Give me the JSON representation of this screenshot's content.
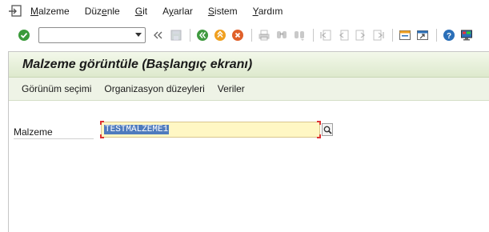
{
  "menubar": {
    "items": [
      {
        "label": "Malzeme",
        "mnemonic_index": 0
      },
      {
        "label": "Düzenle",
        "mnemonic_index": 3
      },
      {
        "label": "Git",
        "mnemonic_index": 0
      },
      {
        "label": "Ayarlar",
        "mnemonic_index": 1
      },
      {
        "label": "Sistem",
        "mnemonic_index": 0
      },
      {
        "label": "Yardım",
        "mnemonic_index": 0
      }
    ],
    "logo_icon": "exit-menu-icon"
  },
  "toolbar": {
    "command_field_value": "",
    "icons": [
      "enter-check-icon",
      "double-left-arrow-icon",
      "save-icon",
      "back-icon",
      "exit-icon",
      "cancel-icon",
      "print-icon",
      "find-icon",
      "find-next-icon",
      "first-page-icon",
      "previous-page-icon",
      "next-page-icon",
      "last-page-icon",
      "create-session-icon",
      "shortcut-icon",
      "help-icon",
      "customize-layout-icon"
    ],
    "colors": {
      "check": "#3a9a3a",
      "back": "#3f9a3f",
      "exit": "#f0a020",
      "cancel": "#e0602a",
      "help": "#2b6fb8"
    }
  },
  "screen": {
    "title": "Malzeme görüntüle (Başlangıç ekranı)",
    "app_toolbar": [
      "Görünüm seçimi",
      "Organizasyon düzeyleri",
      "Veriler"
    ]
  },
  "form": {
    "material_label": "Malzeme",
    "material_value": "TESTMALZEME1",
    "search_icon": "search-help-icon"
  }
}
